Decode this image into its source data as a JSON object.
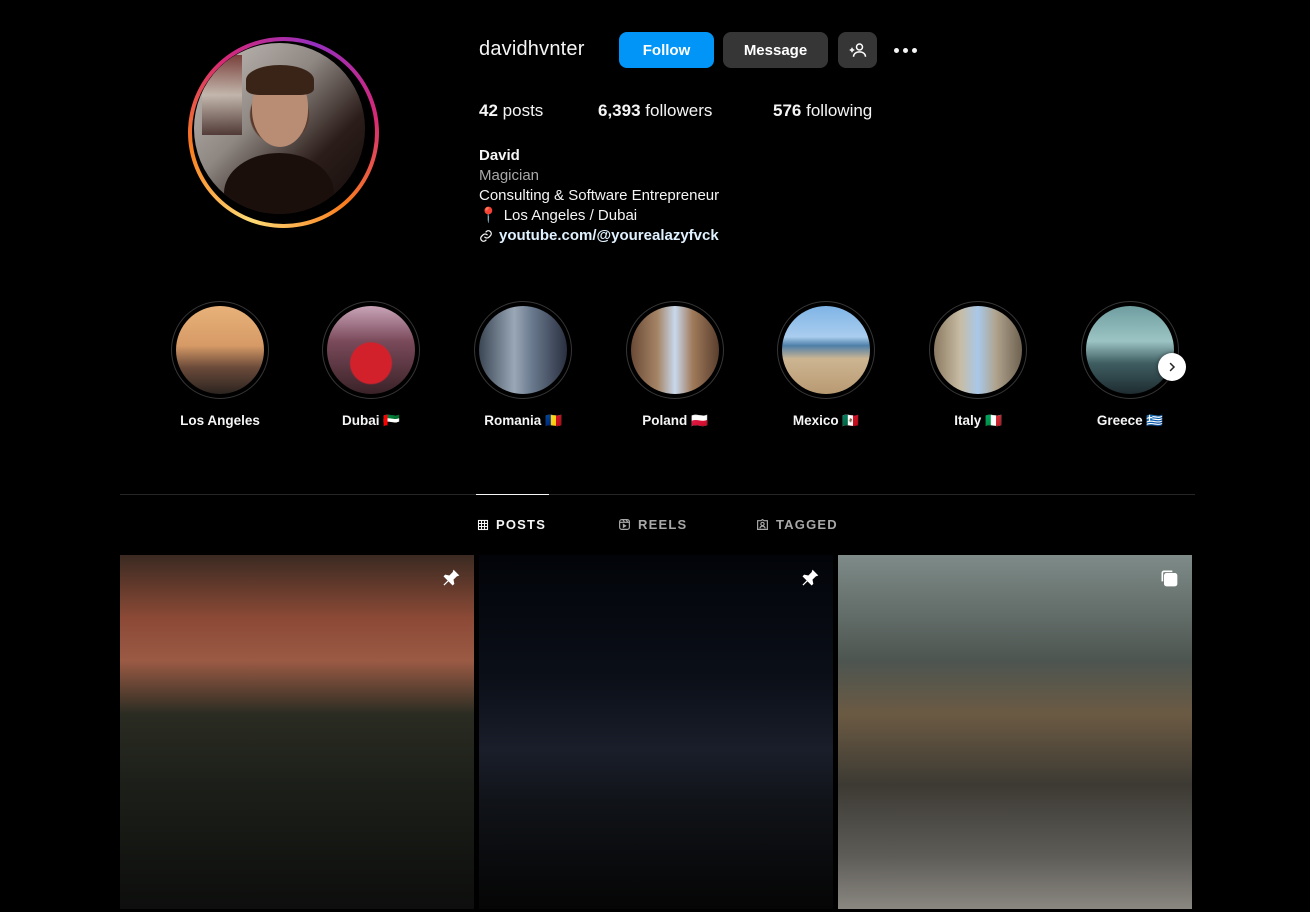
{
  "profile": {
    "username": "davidhvnter",
    "follow_label": "Follow",
    "message_label": "Message",
    "stats": {
      "posts_count": "42",
      "posts_label": "posts",
      "followers_count": "6,393",
      "followers_label": "followers",
      "following_count": "576",
      "following_label": "following"
    },
    "bio": {
      "name": "David",
      "category": "Magician",
      "line1": "Consulting & Software Entrepreneur",
      "location": "Los Angeles / Dubai",
      "link": "youtube.com/@yourealazyfvck"
    }
  },
  "highlights": [
    {
      "label": "Los Angeles"
    },
    {
      "label": "Dubai 🇦🇪"
    },
    {
      "label": "Romania 🇷🇴"
    },
    {
      "label": "Poland 🇵🇱"
    },
    {
      "label": "Mexico 🇲🇽"
    },
    {
      "label": "Italy 🇮🇹"
    },
    {
      "label": "Greece 🇬🇷"
    }
  ],
  "tabs": {
    "posts": "POSTS",
    "reels": "REELS",
    "tagged": "TAGGED",
    "active": "posts"
  },
  "posts": [
    {
      "badge": "pin-icon"
    },
    {
      "badge": "pin-icon"
    },
    {
      "badge": "carousel-icon"
    }
  ],
  "colors": {
    "accent": "#0095f6",
    "secondary_button": "#363636",
    "background": "#000000"
  }
}
